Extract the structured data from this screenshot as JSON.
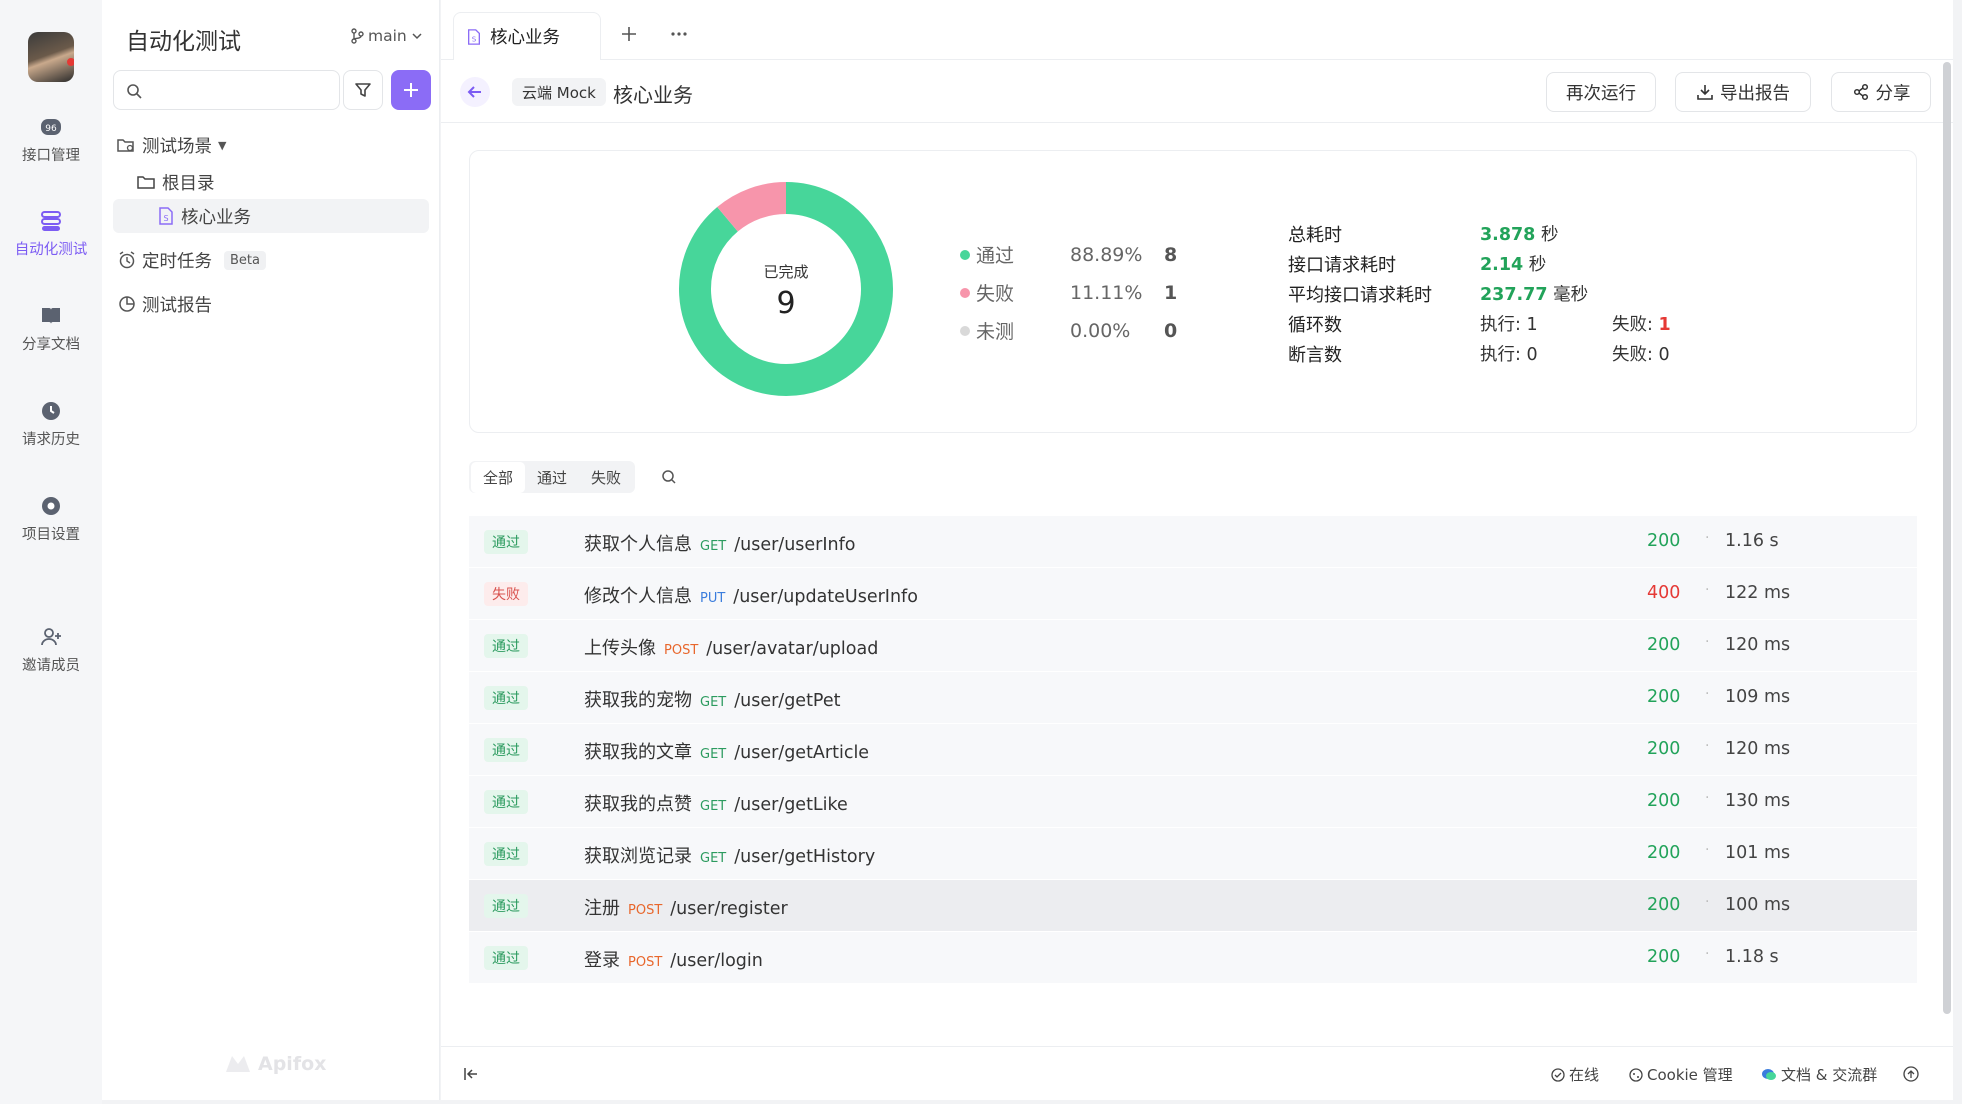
{
  "rail": {
    "items": [
      {
        "label": "接口管理",
        "icon": "api-icon"
      },
      {
        "label": "自动化测试",
        "icon": "automation-icon"
      },
      {
        "label": "分享文档",
        "icon": "book-icon"
      },
      {
        "label": "请求历史",
        "icon": "clock-icon"
      },
      {
        "label": "项目设置",
        "icon": "settings-icon"
      },
      {
        "label": "邀请成员",
        "icon": "add-user-icon"
      }
    ]
  },
  "sidebar": {
    "title": "自动化测试",
    "branch": "main",
    "search_placeholder": "",
    "tree": {
      "scenarios": "测试场景",
      "root": "根目录",
      "selected": "核心业务",
      "scheduled": "定时任务",
      "beta": "Beta",
      "reports": "测试报告"
    },
    "watermark": "Apifox"
  },
  "tab": {
    "label": "核心业务"
  },
  "toolbar": {
    "env": "云端 Mock",
    "title": "核心业务",
    "rerun": "再次运行",
    "export": "导出报告",
    "share": "分享"
  },
  "summary": {
    "center_label": "已完成",
    "center_value": "9",
    "legend": [
      {
        "label": "通过",
        "pct": "88.89%",
        "count": "8",
        "color": "#47d69a"
      },
      {
        "label": "失败",
        "pct": "11.11%",
        "count": "1",
        "color": "#f795ab"
      },
      {
        "label": "未测",
        "pct": "0.00%",
        "count": "0",
        "color": "#d9d9d9"
      }
    ],
    "stats": {
      "total_label": "总耗时",
      "total_val": "3.878",
      "total_unit": "秒",
      "req_label": "接口请求耗时",
      "req_val": "2.14",
      "req_unit": "秒",
      "avg_label": "平均接口请求耗时",
      "avg_val": "237.77",
      "avg_unit": "毫秒",
      "loop_label": "循环数",
      "loop_exec": "执行: 1",
      "loop_fail_label": "失败: ",
      "loop_fail": "1",
      "assert_label": "断言数",
      "assert_exec": "执行: 0",
      "assert_fail": "失败: 0"
    }
  },
  "chart_data": {
    "type": "pie",
    "categories": [
      "通过",
      "失败",
      "未测"
    ],
    "values": [
      8,
      1,
      0
    ],
    "colors": [
      "#47d69a",
      "#f795ab",
      "#d9d9d9"
    ]
  },
  "filters": [
    "全部",
    "通过",
    "失败"
  ],
  "rows": [
    {
      "status": "通过",
      "name": "获取个人信息",
      "method": "GET",
      "path": "/user/userInfo",
      "code": "200",
      "time": "1.16 s"
    },
    {
      "status": "失败",
      "name": "修改个人信息",
      "method": "PUT",
      "path": "/user/updateUserInfo",
      "code": "400",
      "time": "122 ms"
    },
    {
      "status": "通过",
      "name": "上传头像",
      "method": "POST",
      "path": "/user/avatar/upload",
      "code": "200",
      "time": "120 ms"
    },
    {
      "status": "通过",
      "name": "获取我的宠物",
      "method": "GET",
      "path": "/user/getPet",
      "code": "200",
      "time": "109 ms"
    },
    {
      "status": "通过",
      "name": "获取我的文章",
      "method": "GET",
      "path": "/user/getArticle",
      "code": "200",
      "time": "120 ms"
    },
    {
      "status": "通过",
      "name": "获取我的点赞",
      "method": "GET",
      "path": "/user/getLike",
      "code": "200",
      "time": "130 ms"
    },
    {
      "status": "通过",
      "name": "获取浏览记录",
      "method": "GET",
      "path": "/user/getHistory",
      "code": "200",
      "time": "101 ms"
    },
    {
      "status": "通过",
      "name": "注册",
      "method": "POST",
      "path": "/user/register",
      "code": "200",
      "time": "100 ms"
    },
    {
      "status": "通过",
      "name": "登录",
      "method": "POST",
      "path": "/user/login",
      "code": "200",
      "time": "1.18 s"
    }
  ],
  "footer": {
    "online": "在线",
    "cookie": "Cookie 管理",
    "docs": "文档 & 交流群"
  }
}
